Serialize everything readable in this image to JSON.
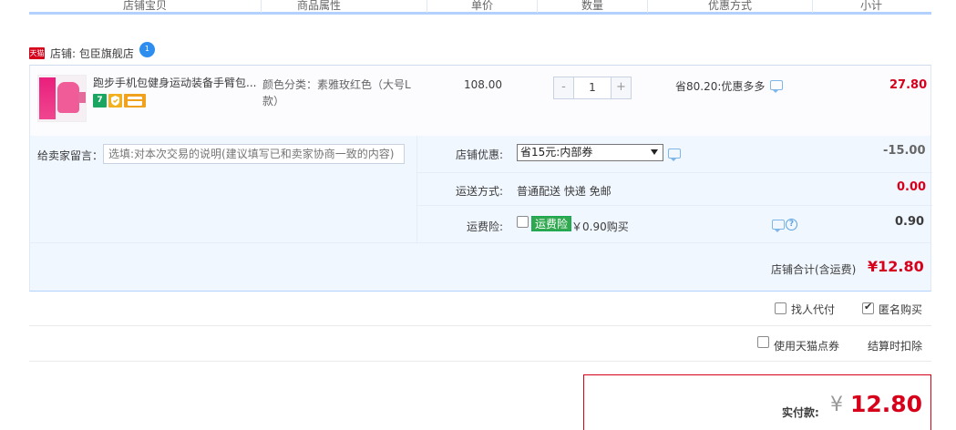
{
  "header": {
    "col_item": "店铺宝贝",
    "col_attr": "商品属性",
    "col_price": "单价",
    "col_qty": "数量",
    "col_discount": "优惠方式",
    "col_subtotal": "小计"
  },
  "shop": {
    "tmall_label": "天猫",
    "name": "店铺: 包臣旗舰店",
    "ww_badge": "1"
  },
  "item": {
    "title": "跑步手机包健身运动装备手臂包...",
    "badge_7": "7",
    "attr": "颜色分类：素雅玫红色（大号L款）",
    "price": "108.00",
    "qty_minus": "-",
    "qty_value": "1",
    "qty_plus": "+",
    "discount": "省80.20:优惠多多",
    "subtotal": "27.80"
  },
  "message": {
    "label": "给卖家留言：",
    "placeholder": "选填:对本次交易的说明(建议填写已和卖家协商一致的内容)"
  },
  "shop_discount": {
    "label": "店铺优惠:",
    "selected": "省15元:内部券",
    "value": "-15.00"
  },
  "shipping": {
    "label": "运送方式:",
    "method": "普通配送 快递 免邮",
    "value": "0.00"
  },
  "insurance": {
    "label": "运费险:",
    "tag": "运费险",
    "text": "￥0.90购买",
    "value": "0.90"
  },
  "shop_total": {
    "label": "店铺合计(含运费)",
    "value": "¥12.80"
  },
  "options": {
    "proxy_label": "找人代付",
    "anonymous_label": "匿名购买",
    "points_label": "使用天猫点券",
    "points_note": "结算时扣除"
  },
  "payment": {
    "label": "实付款:",
    "currency": "¥",
    "value": "12.80"
  },
  "colors": {
    "accent_red": "#d7001b",
    "header_line": "#b2d1ff",
    "panel_bg": "#f1f7ff",
    "insurance_green": "#2fa84f"
  }
}
